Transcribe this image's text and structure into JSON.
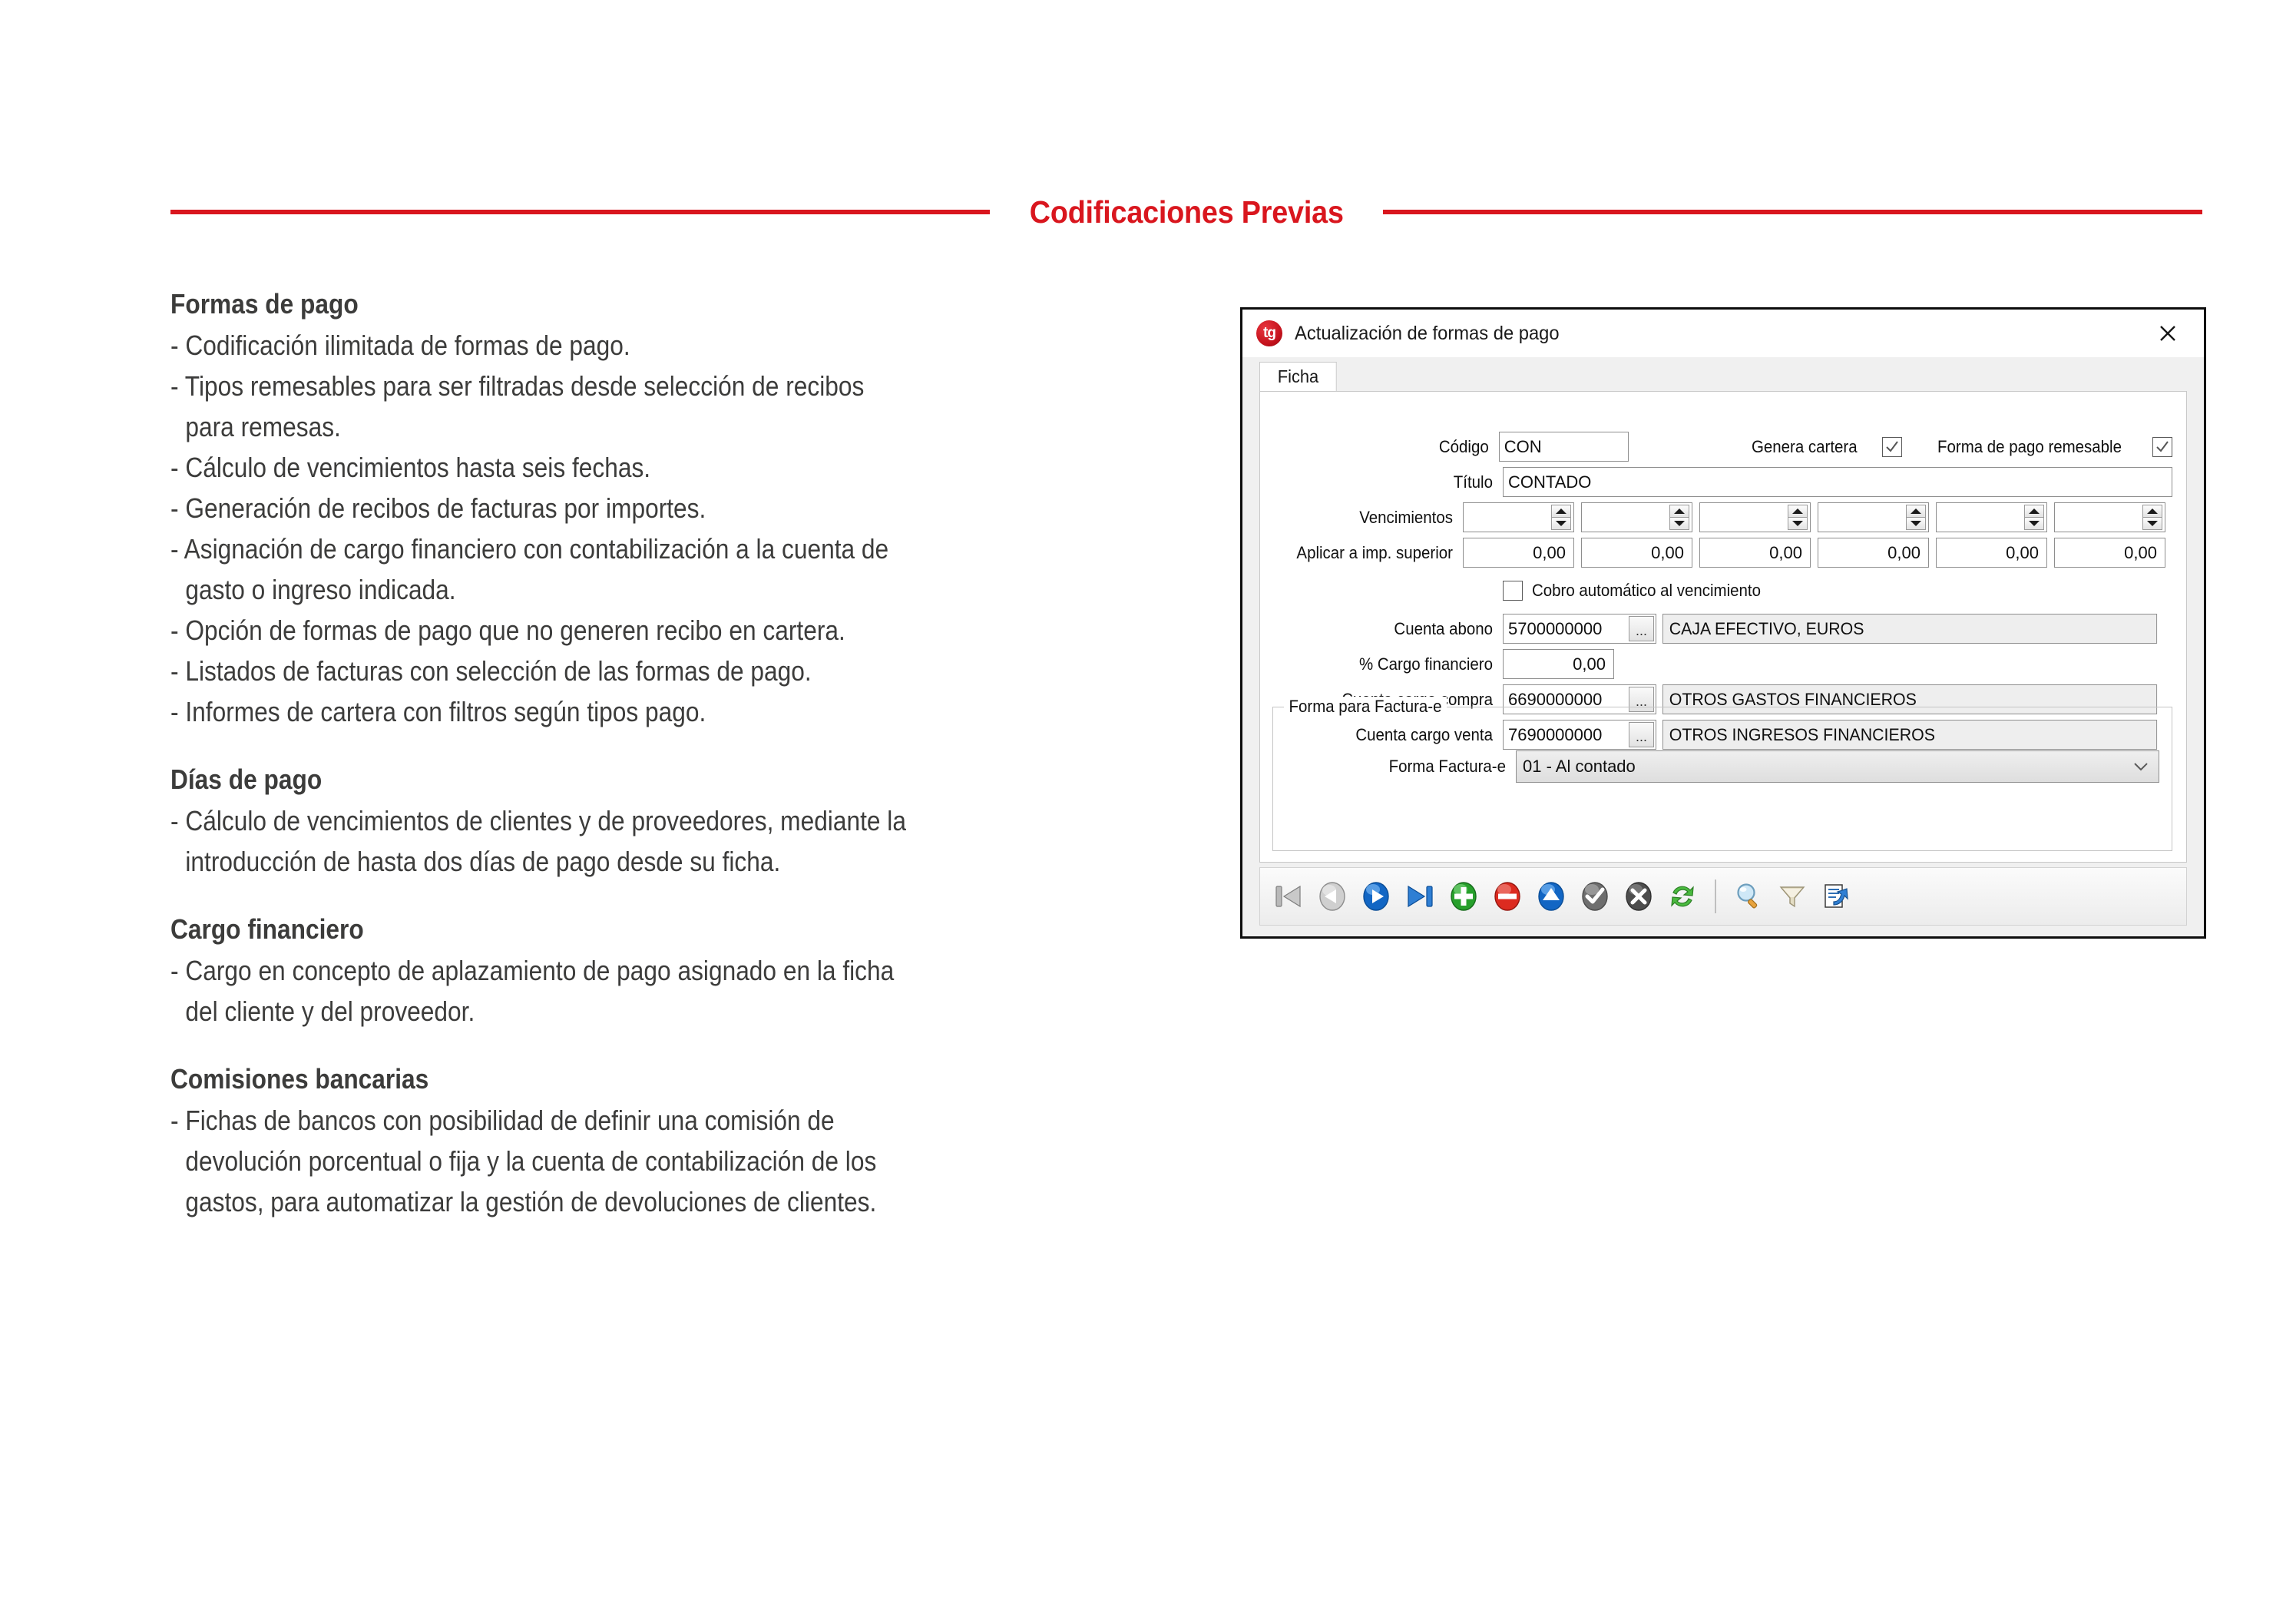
{
  "slide": {
    "title": "Codificaciones Previas",
    "accent_color": "#D9161E",
    "text_color": "#3C3C3B"
  },
  "sections": [
    {
      "heading": "Formas de pago",
      "lines": [
        {
          "text": "- Codificación ilimitada de formas de pago.",
          "continuation": false
        },
        {
          "text": "- Tipos remesables para ser filtradas desde selección de recibos",
          "continuation": false
        },
        {
          "text": "para remesas.",
          "continuation": true
        },
        {
          "text": "- Cálculo de vencimientos hasta seis fechas.",
          "continuation": false
        },
        {
          "text": "- Generación de recibos de facturas por importes.",
          "continuation": false
        },
        {
          "text": "- Asignación de cargo financiero con contabilización a la cuenta de",
          "continuation": false
        },
        {
          "text": "gasto o ingreso indicada.",
          "continuation": true
        },
        {
          "text": "- Opción de formas de pago que no generen recibo en cartera.",
          "continuation": false
        },
        {
          "text": "- Listados de facturas con selección de las formas de pago.",
          "continuation": false
        },
        {
          "text": "- Informes de cartera con filtros según tipos pago.",
          "continuation": false
        }
      ]
    },
    {
      "heading": "Días de pago",
      "lines": [
        {
          "text": "- Cálculo de vencimientos de clientes y de proveedores, mediante la",
          "continuation": false
        },
        {
          "text": "introducción de hasta dos días de pago desde su ficha.",
          "continuation": true
        }
      ]
    },
    {
      "heading": "Cargo financiero",
      "lines": [
        {
          "text": "- Cargo en concepto de aplazamiento de pago asignado en la ficha",
          "continuation": false
        },
        {
          "text": "del cliente y del proveedor.",
          "continuation": true
        }
      ]
    },
    {
      "heading": "Comisiones bancarias",
      "lines": [
        {
          "text": "- Fichas de bancos con posibilidad de definir una comisión de",
          "continuation": false
        },
        {
          "text": "devolución porcentual o fija y la cuenta de contabilización de los",
          "continuation": true
        },
        {
          "text": "gastos, para automatizar la gestión de devoluciones de clientes.",
          "continuation": true
        }
      ]
    }
  ],
  "dialog": {
    "logo_text": "tg",
    "title": "Actualización de formas de pago",
    "close_label": "×",
    "tabs": [
      {
        "label": "Ficha",
        "active": true
      }
    ],
    "fields": {
      "codigo_label": "Código",
      "codigo_value": "CON",
      "genera_cartera_label": "Genera cartera",
      "genera_cartera_checked": true,
      "remesable_label": "Forma de pago remesable",
      "remesable_checked": true,
      "titulo_label": "Título",
      "titulo_value": "CONTADO",
      "vencimientos_label": "Vencimientos",
      "vencimientos_values": [
        "",
        "",
        "",
        "",
        "",
        ""
      ],
      "aplicar_label": "Aplicar a imp. superior",
      "aplicar_values": [
        "0,00",
        "0,00",
        "0,00",
        "0,00",
        "0,00",
        "0,00"
      ],
      "cobro_auto_label": "Cobro automático al vencimiento",
      "cobro_auto_checked": false,
      "cuenta_abono_label": "Cuenta abono",
      "cuenta_abono_code": "5700000000",
      "cuenta_abono_desc": "CAJA EFECTIVO, EUROS",
      "cargo_financiero_label": "% Cargo financiero",
      "cargo_financiero_value": "0,00",
      "cuenta_cargo_compra_label": "Cuenta cargo compra",
      "cuenta_cargo_compra_code": "6690000000",
      "cuenta_cargo_compra_desc": "OTROS GASTOS FINANCIEROS",
      "cuenta_cargo_venta_label": "Cuenta cargo venta",
      "cuenta_cargo_venta_code": "7690000000",
      "cuenta_cargo_venta_desc": "OTROS INGRESOS FINANCIEROS",
      "ellipsis_label": "...",
      "group_legend": "Forma para Factura-e",
      "forma_factura_label": "Forma Factura-e",
      "forma_factura_value": "01 - Al contado",
      "combo_caret": "⌄"
    },
    "toolbar": [
      {
        "name": "first-record",
        "title": "Primero"
      },
      {
        "name": "previous-record",
        "title": "Anterior"
      },
      {
        "name": "next-record",
        "title": "Siguiente"
      },
      {
        "name": "last-record",
        "title": "Último"
      },
      {
        "name": "add-record",
        "title": "Añadir"
      },
      {
        "name": "delete-record",
        "title": "Eliminar"
      },
      {
        "name": "modify-record",
        "title": "Modificar"
      },
      {
        "name": "accept",
        "title": "Aceptar"
      },
      {
        "name": "cancel",
        "title": "Cancelar"
      },
      {
        "name": "refresh",
        "title": "Refrescar"
      },
      {
        "name": "search",
        "title": "Buscar"
      },
      {
        "name": "filter",
        "title": "Filtrar"
      },
      {
        "name": "export",
        "title": "Exportar"
      }
    ]
  }
}
